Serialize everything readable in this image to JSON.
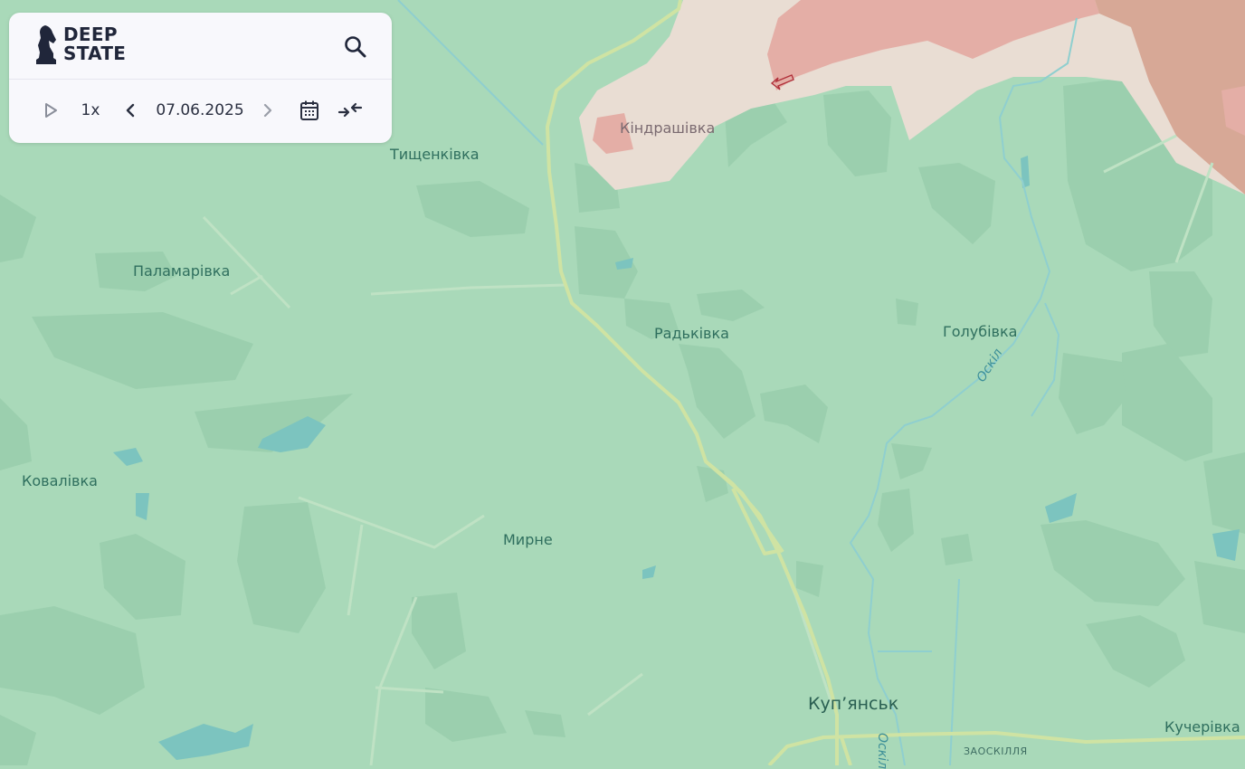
{
  "app": {
    "logo_text_line1": "DEEP",
    "logo_text_line2": "STATE"
  },
  "toolbar": {
    "speed": "1x",
    "date": "07.06.2025",
    "icons": [
      "play-icon",
      "chevron-left-icon",
      "chevron-right-icon",
      "calendar-icon",
      "collapse-arrows-icon",
      "search-icon"
    ]
  },
  "map": {
    "colors": {
      "land": "#a9d9b9",
      "forest": "#9bcfae",
      "occupied_zone": "#e9ddd3",
      "occupied_core": "#e4aea6",
      "frontline_zone": "#d7a896",
      "road": "#cfe3a3",
      "water": "#7cc4bf"
    },
    "labels": {
      "tyshchenkivka": "Тищенківка",
      "kindrashivka": "Кіндрашівка",
      "palamarivka": "Паламарівка",
      "radkivka": "Радьківка",
      "holubivka": "Голубівка",
      "kovalivka": "Ковалівка",
      "myrne": "Мирне",
      "kupiansk": "Куп’янськ",
      "kucherivka": "Кучерівка",
      "zaoskillia": "ЗАОСКІЛЛЯ"
    },
    "rivers": {
      "oskil_upper": "Оскіл",
      "oskil_lower": "Оскіл"
    }
  }
}
